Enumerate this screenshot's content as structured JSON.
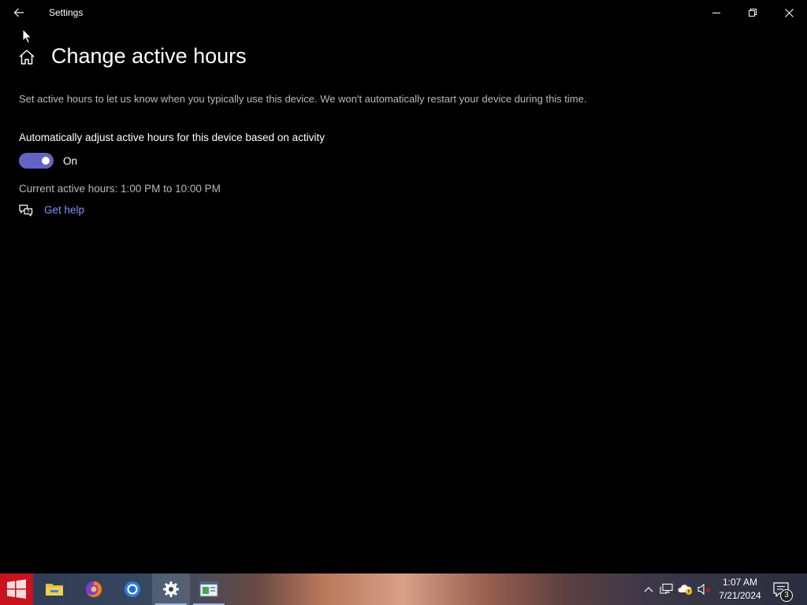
{
  "window": {
    "title": "Settings"
  },
  "page": {
    "title": "Change active hours",
    "description": "Set active hours to let us know when you typically use this device. We won't automatically restart your device during this time.",
    "toggle_label": "Automatically adjust active hours for this device based on activity",
    "toggle_state": "On",
    "toggle_on": true,
    "current_hours": "Current active hours: 1:00 PM to 10:00 PM",
    "help_link": "Get help"
  },
  "taskbar": {
    "apps": [
      {
        "name": "start",
        "icon": "windows-logo-icon"
      },
      {
        "name": "file-explorer",
        "icon": "folder-icon"
      },
      {
        "name": "firefox",
        "icon": "firefox-icon"
      },
      {
        "name": "chrome",
        "icon": "chrome-icon"
      },
      {
        "name": "settings",
        "icon": "gear-icon",
        "active": true
      },
      {
        "name": "app",
        "icon": "window-app-icon"
      }
    ],
    "clock_time": "1:07 AM",
    "clock_date": "7/21/2024",
    "notification_count": "3"
  },
  "colors": {
    "accent": "#6264c4",
    "link": "#8d8ff0",
    "background": "#000000",
    "secondary_text": "#b8b8b8"
  }
}
